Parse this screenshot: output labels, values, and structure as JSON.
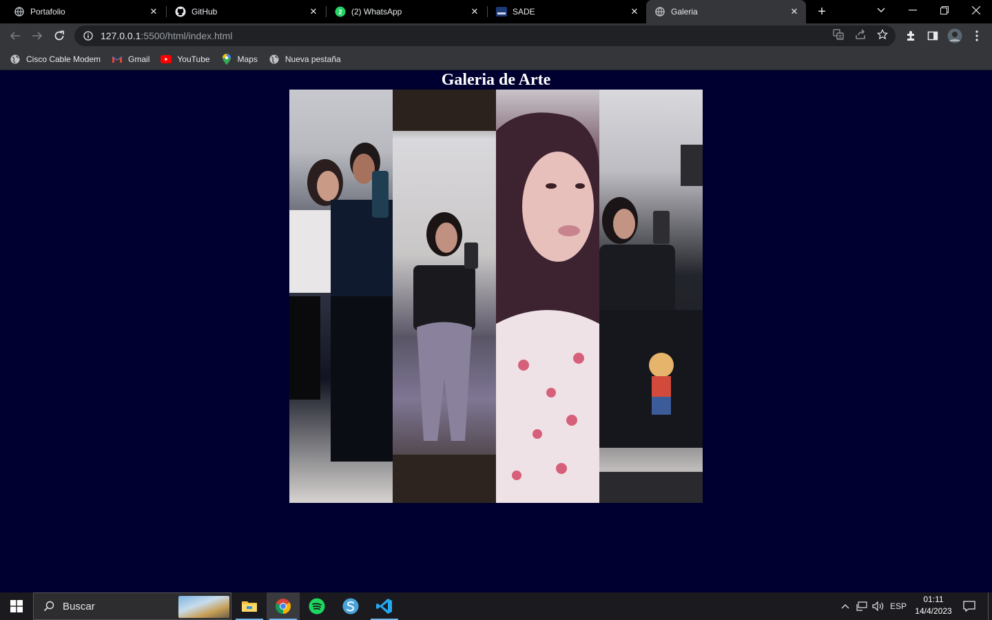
{
  "browser": {
    "tabs": [
      {
        "title": "Portafolio",
        "icon": "globe-icon",
        "active": false
      },
      {
        "title": "GitHub",
        "icon": "github-icon",
        "active": false
      },
      {
        "title": "(2) WhatsApp",
        "icon": "whatsapp-icon",
        "badge": "2",
        "active": false
      },
      {
        "title": "SADE",
        "icon": "sade-icon",
        "active": false
      },
      {
        "title": "Galeria",
        "icon": "globe-icon",
        "active": true
      }
    ],
    "url_host": "127.0.0.1",
    "url_rest": ":5500/html/index.html",
    "bookmarks": [
      {
        "label": "Cisco Cable Modem",
        "icon": "globe-icon"
      },
      {
        "label": "Gmail",
        "icon": "gmail-icon"
      },
      {
        "label": "YouTube",
        "icon": "youtube-icon"
      },
      {
        "label": "Maps",
        "icon": "maps-icon"
      },
      {
        "label": "Nueva pestaña",
        "icon": "globe-icon"
      }
    ]
  },
  "page": {
    "heading": "Galeria de Arte",
    "photos": [
      {
        "alt": "photo-1"
      },
      {
        "alt": "photo-2"
      },
      {
        "alt": "photo-3"
      },
      {
        "alt": "photo-4"
      }
    ],
    "background_color": "#000030"
  },
  "taskbar": {
    "search_placeholder": "Buscar",
    "language": "ESP",
    "time": "01:11",
    "date": "14/4/2023",
    "apps": [
      "file-explorer-icon",
      "chrome-icon",
      "spotify-icon",
      "app-s-icon",
      "vscode-icon"
    ]
  }
}
